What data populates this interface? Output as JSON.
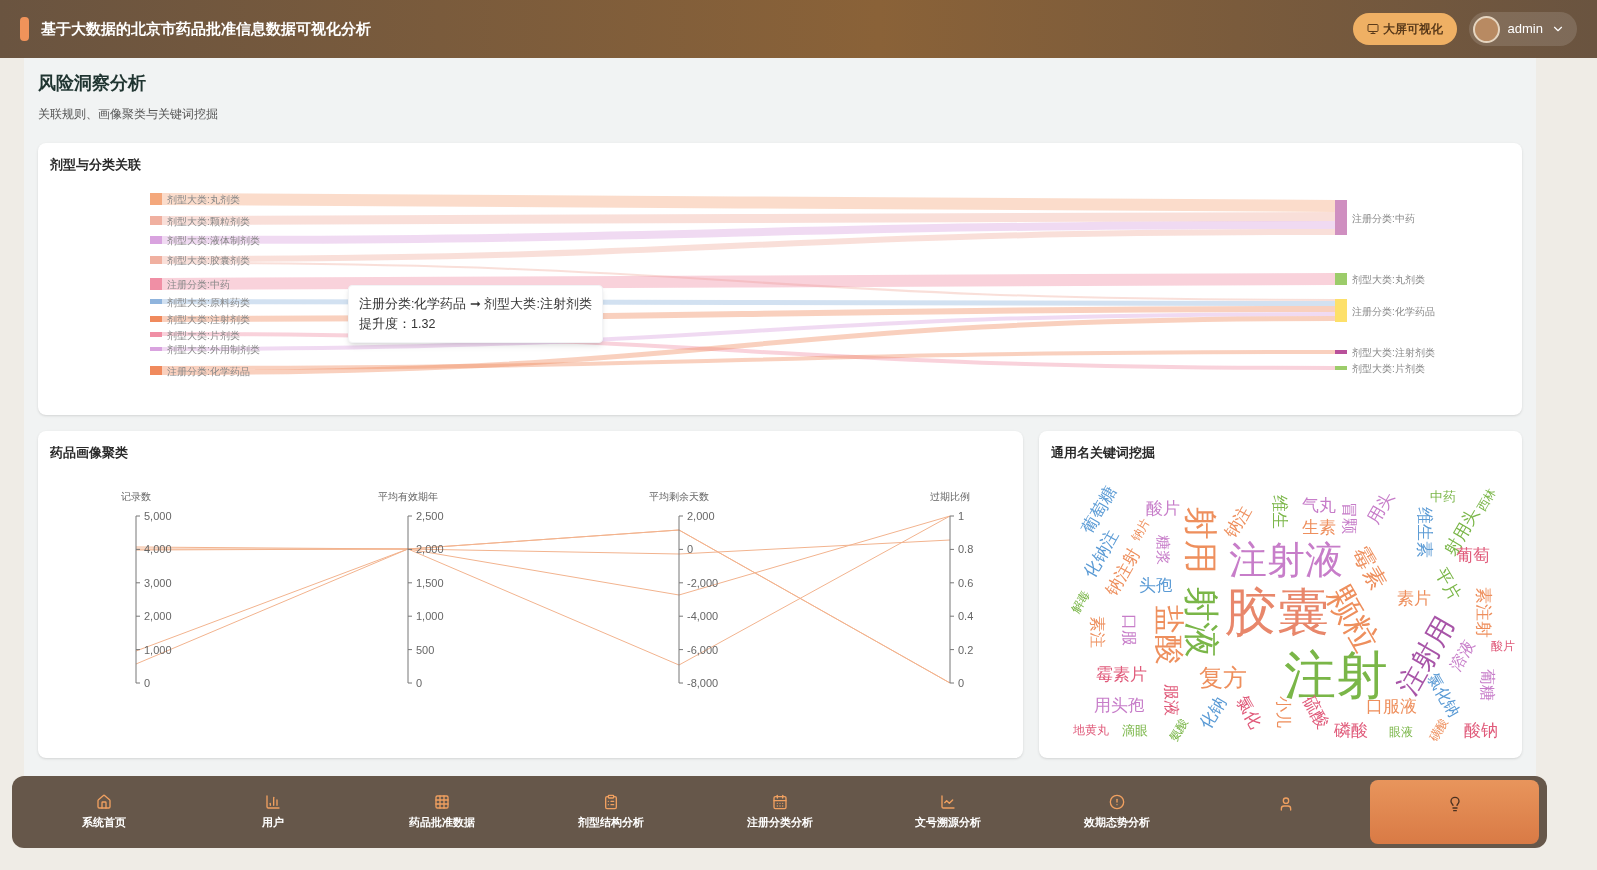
{
  "header": {
    "title": "基于大数据的北京市药品批准信息数据可视化分析",
    "screen_button": "大屏可视化",
    "user": "admin"
  },
  "page": {
    "title": "风险洞察分析",
    "subtitle": "关联规则、画像聚类与关键词挖掘"
  },
  "sankey": {
    "title": "剂型与分类关联",
    "left_nodes": [
      {
        "label": "剂型大类:丸剂类",
        "color": "#f4a87c"
      },
      {
        "label": "剂型大类:颗粒剂类",
        "color": "#f0b0a0"
      },
      {
        "label": "剂型大类:液体制剂类",
        "color": "#d9a3df"
      },
      {
        "label": "剂型大类:胶囊剂类",
        "color": "#f0b0a0"
      },
      {
        "label": "注册分类:中药",
        "color": "#f08fa5"
      },
      {
        "label": "剂型大类:原料药类",
        "color": "#8fb4dd"
      },
      {
        "label": "剂型大类:注射剂类",
        "color": "#f08a5d"
      },
      {
        "label": "剂型大类:片剂类",
        "color": "#f08fa5"
      },
      {
        "label": "剂型大类:外用制剂类",
        "color": "#d9a3df"
      },
      {
        "label": "注册分类:化学药品",
        "color": "#f08a5d"
      }
    ],
    "right_nodes": [
      {
        "label": "注册分类:中药",
        "color": "#cf8fc0"
      },
      {
        "label": "剂型大类:丸剂类",
        "color": "#9ccc6a"
      },
      {
        "label": "注册分类:化学药品",
        "color": "#fde06a"
      },
      {
        "label": "剂型大类:注射剂类",
        "color": "#b8509a"
      },
      {
        "label": "剂型大类:片剂类",
        "color": "#9ccc6a"
      }
    ],
    "tooltip": {
      "rule": "注册分类:化学药品 ➞ 剂型大类:注射剂类",
      "lift": "提升度：1.32"
    }
  },
  "clusters": {
    "title": "药品画像聚类",
    "axes": [
      {
        "name": "记录数",
        "ticks": [
          "5,000",
          "4,000",
          "3,000",
          "2,000",
          "1,000",
          "0"
        ]
      },
      {
        "name": "平均有效期年",
        "ticks": [
          "2,500",
          "2,000",
          "1,500",
          "1,000",
          "500",
          "0"
        ]
      },
      {
        "name": "平均剩余天数",
        "ticks": [
          "2,000",
          "0",
          "-2,000",
          "-4,000",
          "-6,000",
          "-8,000"
        ]
      },
      {
        "name": "过期比例",
        "ticks": [
          "1",
          "0.8",
          "0.6",
          "0.4",
          "0.2",
          "0"
        ]
      }
    ]
  },
  "wordcloud": {
    "title": "通用名关键词挖掘",
    "words": [
      {
        "text": "葡萄糖",
        "color": "#5b9bd5"
      },
      {
        "text": "酸片",
        "color": "#c77dc9"
      },
      {
        "text": "射用",
        "color": "#ee8f5d"
      },
      {
        "text": "钠注",
        "color": "#ee8f5d"
      },
      {
        "text": "维生",
        "color": "#7ab648"
      },
      {
        "text": "气丸",
        "color": "#c77dc9"
      },
      {
        "text": "生素",
        "color": "#ee8f5d"
      },
      {
        "text": "冒颗",
        "color": "#c77dc9"
      },
      {
        "text": "用头",
        "color": "#c77dc9"
      },
      {
        "text": "维生素",
        "color": "#5b9bd5"
      },
      {
        "text": "射用头",
        "color": "#7ab648"
      },
      {
        "text": "中药",
        "color": "#7ab648"
      },
      {
        "text": "西林",
        "color": "#7ab648"
      },
      {
        "text": "化钠注",
        "color": "#5b9bd5"
      },
      {
        "text": "钠片",
        "color": "#ee8f5d"
      },
      {
        "text": "钠注射",
        "color": "#ee8f5d"
      },
      {
        "text": "糖浆",
        "color": "#c77dc9"
      },
      {
        "text": "注射液",
        "color": "#c77dc9"
      },
      {
        "text": "霉素",
        "color": "#ee8f5d"
      },
      {
        "text": "葡萄",
        "color": "#e05a7a"
      },
      {
        "text": "头孢",
        "color": "#5b9bd5"
      },
      {
        "text": "射液",
        "color": "#7ab648"
      },
      {
        "text": "胶囊",
        "color": "#e8876b"
      },
      {
        "text": "颗粒",
        "color": "#ee8f5d"
      },
      {
        "text": "素片",
        "color": "#ee8f5d"
      },
      {
        "text": "平片",
        "color": "#7ab648"
      },
      {
        "text": "素注射",
        "color": "#ee8f5d"
      },
      {
        "text": "解毒",
        "color": "#7ab648"
      },
      {
        "text": "素注",
        "color": "#ee8f5d"
      },
      {
        "text": "口服",
        "color": "#c77dc9"
      },
      {
        "text": "盐酸",
        "color": "#ee8f5d"
      },
      {
        "text": "酸片",
        "color": "#e05a7a"
      },
      {
        "text": "注射用",
        "color": "#a855a8"
      },
      {
        "text": "溶液",
        "color": "#c77dc9"
      },
      {
        "text": "葡糖",
        "color": "#c77dc9"
      },
      {
        "text": "霉素片",
        "color": "#e05a7a"
      },
      {
        "text": "复方",
        "color": "#ee8f5d"
      },
      {
        "text": "注射",
        "color": "#7ab648"
      },
      {
        "text": "氯化钠",
        "color": "#5b9bd5"
      },
      {
        "text": "用头孢",
        "color": "#c77dc9"
      },
      {
        "text": "服液",
        "color": "#e05a7a"
      },
      {
        "text": "化钠",
        "color": "#5b9bd5"
      },
      {
        "text": "氯化",
        "color": "#e05a7a"
      },
      {
        "text": "小儿",
        "color": "#ee8f5d"
      },
      {
        "text": "硫酸",
        "color": "#e05a7a"
      },
      {
        "text": "口服液",
        "color": "#ee8f5d"
      },
      {
        "text": "地黄丸",
        "color": "#e05a7a"
      },
      {
        "text": "滴眼",
        "color": "#7ab648"
      },
      {
        "text": "氨酸",
        "color": "#7ab648"
      },
      {
        "text": "磷酸",
        "color": "#e05a7a"
      },
      {
        "text": "眼液",
        "color": "#7ab648"
      },
      {
        "text": "磺酸",
        "color": "#ee8f5d"
      },
      {
        "text": "酸钠",
        "color": "#e05a7a"
      }
    ]
  },
  "nav": [
    {
      "label": "系统首页",
      "selected": false
    },
    {
      "label": "用户",
      "selected": false
    },
    {
      "label": "药品批准数据",
      "selected": false
    },
    {
      "label": "剂型结构分析",
      "selected": false
    },
    {
      "label": "注册分类分析",
      "selected": false
    },
    {
      "label": "文号溯源分析",
      "selected": false
    },
    {
      "label": "效期态势分析",
      "selected": false
    },
    {
      "selected": false
    },
    {
      "selected": true
    }
  ]
}
